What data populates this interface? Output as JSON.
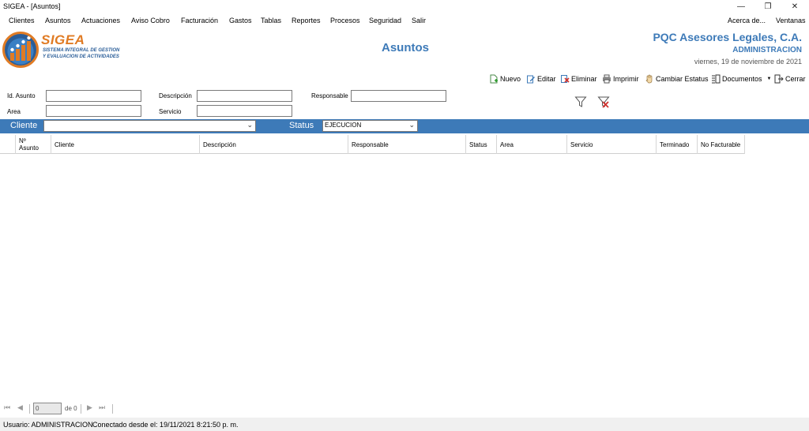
{
  "window": {
    "title": "SIGEA - [Asuntos]",
    "controls": {
      "minimize": "—",
      "restore": "❐",
      "close": "✕"
    }
  },
  "menu": {
    "items": [
      "Clientes",
      "Asuntos",
      "Actuaciones",
      "Aviso Cobro",
      "Facturación",
      "Gastos",
      "Tablas",
      "Reportes",
      "Procesos",
      "Seguridad",
      "Salir"
    ],
    "right_items": [
      "Acerca de...",
      "Ventanas"
    ]
  },
  "header": {
    "logo_title": "SIGEA",
    "logo_line1": "SISTEMA INTEGRAL DE GESTION",
    "logo_line2": "Y EVALUACION DE ACTIVIDADES",
    "page_title": "Asuntos",
    "company": "PQC Asesores Legales, C.A.",
    "user_role": "ADMINISTRACION",
    "date": "viernes, 19 de noviembre de 2021"
  },
  "toolbar": {
    "nuevo": "Nuevo",
    "editar": "Editar",
    "eliminar": "Eliminar",
    "imprimir": "Imprimir",
    "cambiar_estatus": "Cambiar Estatus",
    "documentos": "Documentos",
    "cerrar": "Cerrar"
  },
  "filters": {
    "id_asunto_label": "Id. Asunto",
    "id_asunto_value": "",
    "descripcion_label": "Descripción",
    "descripcion_value": "",
    "responsable_label": "Responsable",
    "responsable_value": "",
    "area_label": "Area",
    "area_value": "",
    "servicio_label": "Servicio",
    "servicio_value": ""
  },
  "bluebar": {
    "cliente_label": "Cliente",
    "cliente_value": "",
    "status_label": "Status",
    "status_value": "EJECUCION"
  },
  "grid": {
    "columns": [
      {
        "line1": "Nº",
        "line2": "Asunto"
      },
      {
        "line1": "Cliente",
        "line2": ""
      },
      {
        "line1": "Descripción",
        "line2": ""
      },
      {
        "line1": "Responsable",
        "line2": ""
      },
      {
        "line1": "Status",
        "line2": ""
      },
      {
        "line1": "Area",
        "line2": ""
      },
      {
        "line1": "Servicio",
        "line2": ""
      },
      {
        "line1": "Terminado",
        "line2": ""
      },
      {
        "line1": "No Facturable",
        "line2": ""
      }
    ],
    "rows": []
  },
  "navigator": {
    "first": "⏮",
    "prev": "◀",
    "position": "0",
    "of_label": "de 0",
    "next": "▶",
    "last": "⏭"
  },
  "status": {
    "user": "Usuario: ADMINISTRACION",
    "connected": "Conectado desde el: 19/11/2021 8:21:50 p. m."
  },
  "colors": {
    "accent_blue": "#3d7ab8",
    "logo_orange": "#e07b24",
    "delete_red": "#d0312d"
  }
}
